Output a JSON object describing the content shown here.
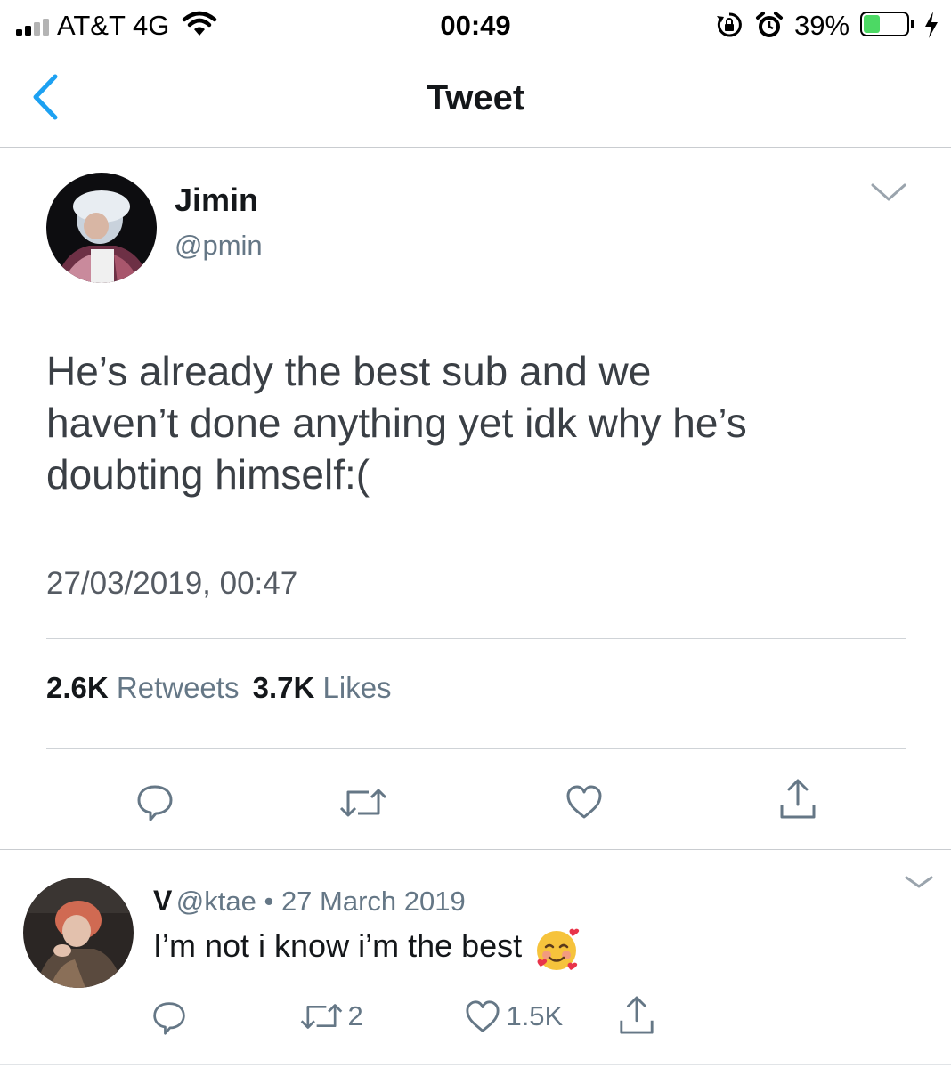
{
  "status_bar": {
    "carrier": "AT&T 4G",
    "time": "00:49",
    "battery_percent": "39%",
    "battery_level": 0.39,
    "signal_bars_filled": 2,
    "icons": [
      "signal-icon",
      "wifi-icon",
      "orientation-lock-icon",
      "alarm-icon",
      "battery-icon",
      "charging-icon"
    ]
  },
  "nav": {
    "title": "Tweet",
    "back_icon": "chevron-left-icon"
  },
  "tweet": {
    "author_name": "Jimin",
    "author_handle": "@pmin",
    "text_lines": [
      "He’s already the best sub and we",
      "haven’t done anything yet idk why he’s",
      "doubting himself:("
    ],
    "timestamp": "27/03/2019, 00:47",
    "retweets_count": "2.6K",
    "retweets_label": "Retweets",
    "likes_count": "3.7K",
    "likes_label": "Likes",
    "actions": [
      "reply-icon",
      "retweet-icon",
      "like-icon",
      "share-icon"
    ]
  },
  "reply": {
    "author_name": "V",
    "meta": "@ktae • 27 March 2019",
    "text": "I’m not i know i’m the best",
    "emoji": "🥰",
    "retweets_count": "2",
    "likes_count": "1.5K"
  },
  "colors": {
    "accent": "#1da1f2",
    "secondary_text": "#657786",
    "battery_green": "#4cd964",
    "divider": "#cfd3d7"
  }
}
